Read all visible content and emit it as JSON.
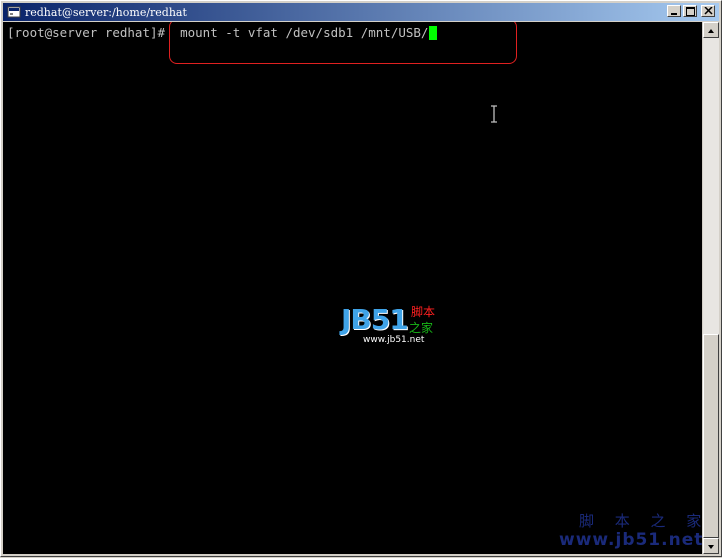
{
  "window": {
    "title": "redhat@server:/home/redhat",
    "icons": {
      "app": "terminal-app-icon",
      "minimize": "minimize-icon",
      "maximize": "maximize-icon",
      "close": "close-icon"
    }
  },
  "terminal": {
    "prompt": "[root@server redhat]#",
    "command": "  mount -t vfat /dev/sdb1 /mnt/USB/",
    "colors": {
      "background": "#000000",
      "text": "#c0c0c0",
      "cursor": "#00ff00",
      "highlight": "#e02020"
    }
  },
  "watermark": {
    "logo": "JB51",
    "cn_line1": "脚本",
    "cn_line2": "之家",
    "url": "www.jb51.net"
  },
  "corner_watermark": {
    "line1": "脚 本 之 家",
    "line2": "www.jb51.net"
  }
}
